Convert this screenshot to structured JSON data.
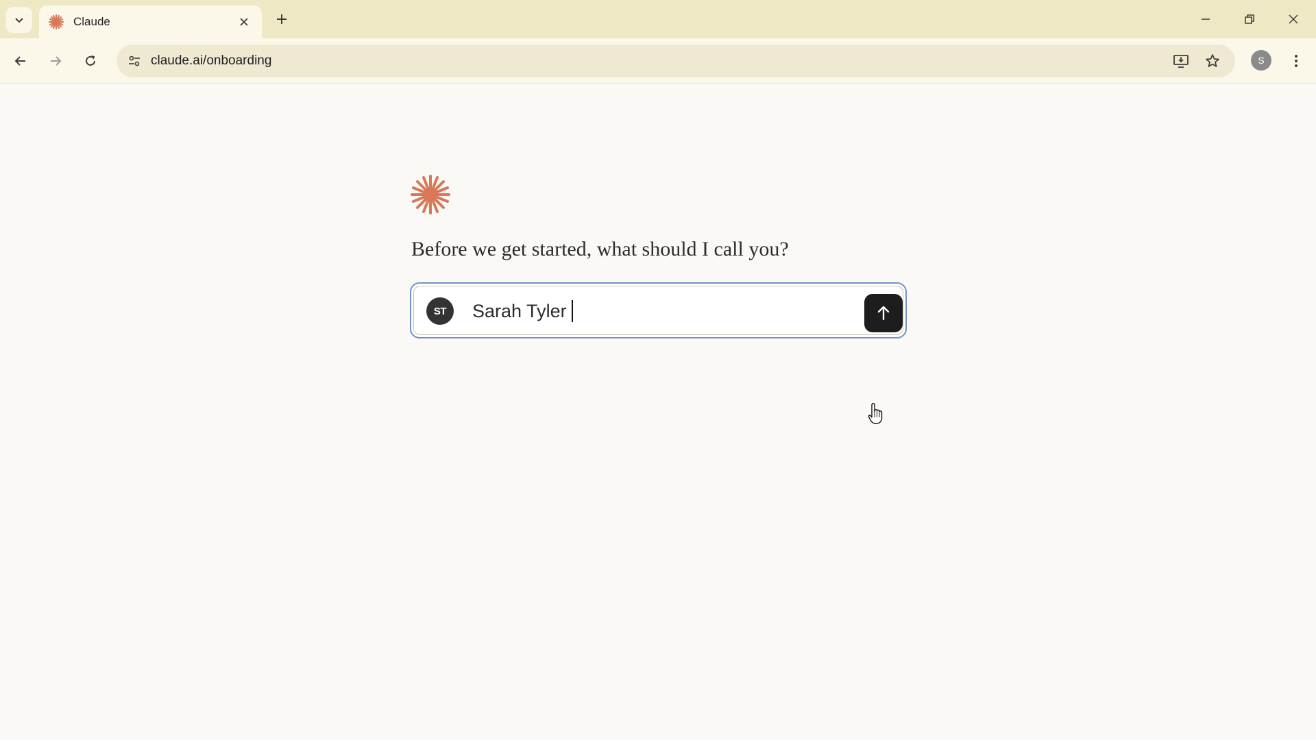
{
  "browser": {
    "tab_title": "Claude",
    "url": "claude.ai/onboarding",
    "profile_initial": "S"
  },
  "onboarding": {
    "question": "Before we get started, what should I call you?",
    "avatar_initials": "ST",
    "name_value": "Sarah Tyler",
    "accent_color": "#d97757"
  },
  "icons": [
    "tab-search-icon",
    "claude-favicon-icon",
    "close-icon",
    "plus-icon",
    "minimize-icon",
    "restore-icon",
    "window-close-icon",
    "back-icon",
    "forward-icon",
    "reload-icon",
    "site-info-icon",
    "install-app-icon",
    "bookmark-star-icon",
    "kebab-menu-icon",
    "claude-logo-icon",
    "arrow-up-icon",
    "hand-pointer-icon"
  ]
}
